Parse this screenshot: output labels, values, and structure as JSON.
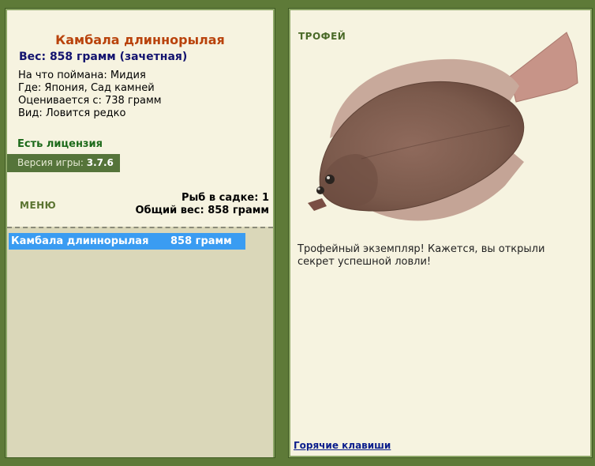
{
  "fish": {
    "name": "Камбала длиннорылая",
    "weight_line": "Вес: 858 грамм (зачетная)",
    "bait": "На что поймана: Мидия",
    "location": "Где: Япония, Сад камней",
    "rated_from": "Оценивается с: 738 грамм",
    "kind": "Вид: Ловится редко"
  },
  "license": "Есть лицензия",
  "version": {
    "label": "Версия игры:",
    "value": "3.7.6"
  },
  "menu_label": "МЕНЮ",
  "stats": {
    "count": "Рыб в садке: 1",
    "total": "Общий вес: 858 грамм"
  },
  "keepnet": [
    {
      "name": "Камбала длиннорылая",
      "weight": "858 грамм"
    }
  ],
  "trophy": {
    "label": "ТРОФЕЙ",
    "text": "Трофейный экземпляр! Кажется, вы открыли секрет успешной ловли!"
  },
  "hotkeys": "Горячие клавиши",
  "colors": {
    "frame": "#5e7a38",
    "panel": "#f6f3e0",
    "keepnet": "#dad7b9",
    "selected_row": "#3a9cf2",
    "title": "#b9430c",
    "weight": "#13136f",
    "license": "#1d6a1a"
  }
}
